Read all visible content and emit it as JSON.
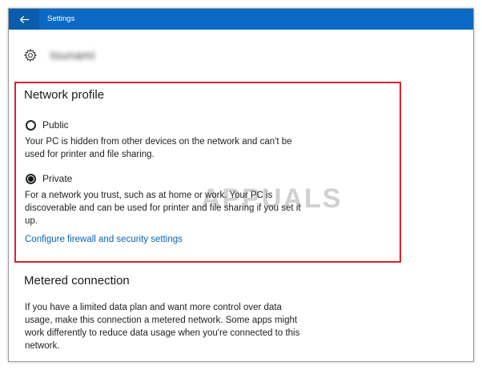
{
  "window": {
    "title": "Settings"
  },
  "header": {
    "network_name": "tsunami"
  },
  "network_profile": {
    "title": "Network profile",
    "public": {
      "label": "Public",
      "selected": false,
      "description": "Your PC is hidden from other devices on the network and can't be used for printer and file sharing."
    },
    "private": {
      "label": "Private",
      "selected": true,
      "description": "For a network you trust, such as at home or work. Your PC is discoverable and can be used for printer and file sharing if you set it up."
    },
    "firewall_link": "Configure firewall and security settings"
  },
  "metered": {
    "title": "Metered connection",
    "description": "If you have a limited data plan and want more control over data usage, make this connection a metered network. Some apps might work differently to reduce data usage when you're connected to this network."
  },
  "watermark": {
    "text": "APPUALS"
  },
  "colors": {
    "titlebar": "#0a69c4",
    "highlight_border": "#d9232d",
    "link": "#0863b5"
  },
  "icons": [
    "back-arrow-icon",
    "gear-icon"
  ]
}
